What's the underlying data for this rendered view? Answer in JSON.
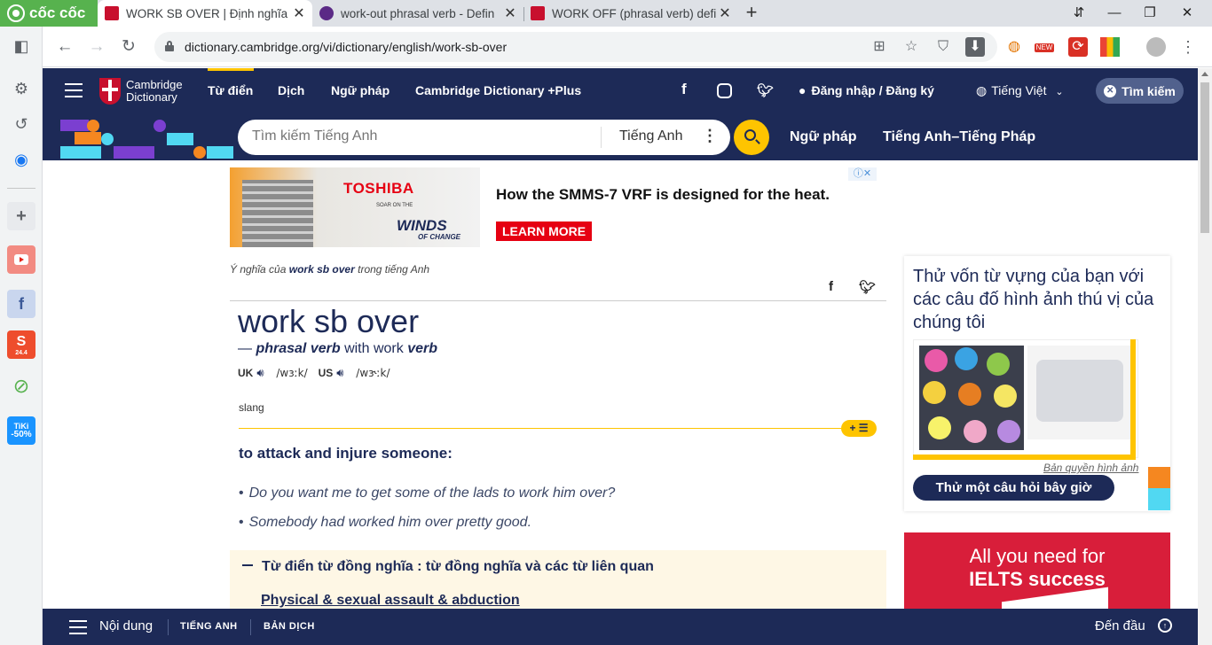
{
  "browser": {
    "logo_text": "cốc cốc",
    "tabs": [
      {
        "title": "WORK SB OVER | Định nghĩa",
        "active": true,
        "favicon_color": "#c8102e"
      },
      {
        "title": "work-out phrasal verb - Defin",
        "active": false,
        "favicon_color": "#5b2a86"
      },
      {
        "title": "WORK OFF (phrasal verb) defi",
        "active": false,
        "favicon_color": "#c8102e"
      }
    ],
    "url": "dictionary.cambridge.org/vi/dictionary/english/work-sb-over",
    "extension_badge": "NEW"
  },
  "sidebar": {
    "tiki_label": "TiKi",
    "tiki_discount": "-50%",
    "shopee_label": "24.4"
  },
  "header": {
    "logo_line1": "Cambridge",
    "logo_line2": "Dictionary",
    "nav": [
      "Từ điển",
      "Dịch",
      "Ngữ pháp",
      "Cambridge Dictionary +Plus"
    ],
    "login": "Đăng nhập / Đăng ký",
    "language": "Tiếng Việt",
    "search_toggle": "Tìm kiếm",
    "colors": {
      "navy": "#1d2a57",
      "yellow": "#fec400"
    }
  },
  "search": {
    "placeholder": "Tìm kiếm Tiếng Anh",
    "dictionary": "Tiếng Anh",
    "links": [
      "Ngữ pháp",
      "Tiếng Anh–Tiếng Pháp"
    ]
  },
  "ad": {
    "brand": "TOSHIBA",
    "tagline_small": "SOAR ON THE",
    "tagline_big": "WINDS",
    "tagline_end": "OF CHANGE",
    "headline": "How the SMMS-7 VRF is designed for the heat.",
    "cta": "LEARN MORE",
    "choices_icon": "ⓘ✕"
  },
  "entry": {
    "crumb_prefix": "Ý nghĩa của",
    "crumb_word": "work sb over",
    "crumb_suffix": "trong tiếng Anh",
    "headword": "work sb over",
    "pos_dash": "—",
    "pos": "phrasal verb",
    "pos_with": "with work",
    "pos_verb": "verb",
    "uk_label": "UK",
    "uk_ipa": "/wɜːk/",
    "us_label": "US",
    "us_ipa": "/wɝːk/",
    "grammar": "slang",
    "sense_button": "+ ☰",
    "definition": "to attack and injure someone:",
    "examples": [
      "Do you want me to get some of the lads to work him over?",
      "Somebody had worked him over pretty good."
    ],
    "thesaurus_title": "Từ điển từ đồng nghĩa : từ đồng nghĩa và các từ liên quan",
    "thesaurus_link": "Physical & sexual assault & abduction"
  },
  "quiz": {
    "title": "Thử vốn từ vựng của bạn với các câu đố hình ảnh thú vị của chúng tôi",
    "credit": "Bản quyền hình ảnh",
    "button": "Thử một câu hỏi bây giờ"
  },
  "ielts_ad": {
    "line1": "All you need for",
    "line2": "IELTS success"
  },
  "bottom_bar": {
    "contents": "Nội dung",
    "tabs": [
      "TIẾNG ANH",
      "BẢN DỊCH"
    ],
    "to_top": "Đến đầu"
  }
}
